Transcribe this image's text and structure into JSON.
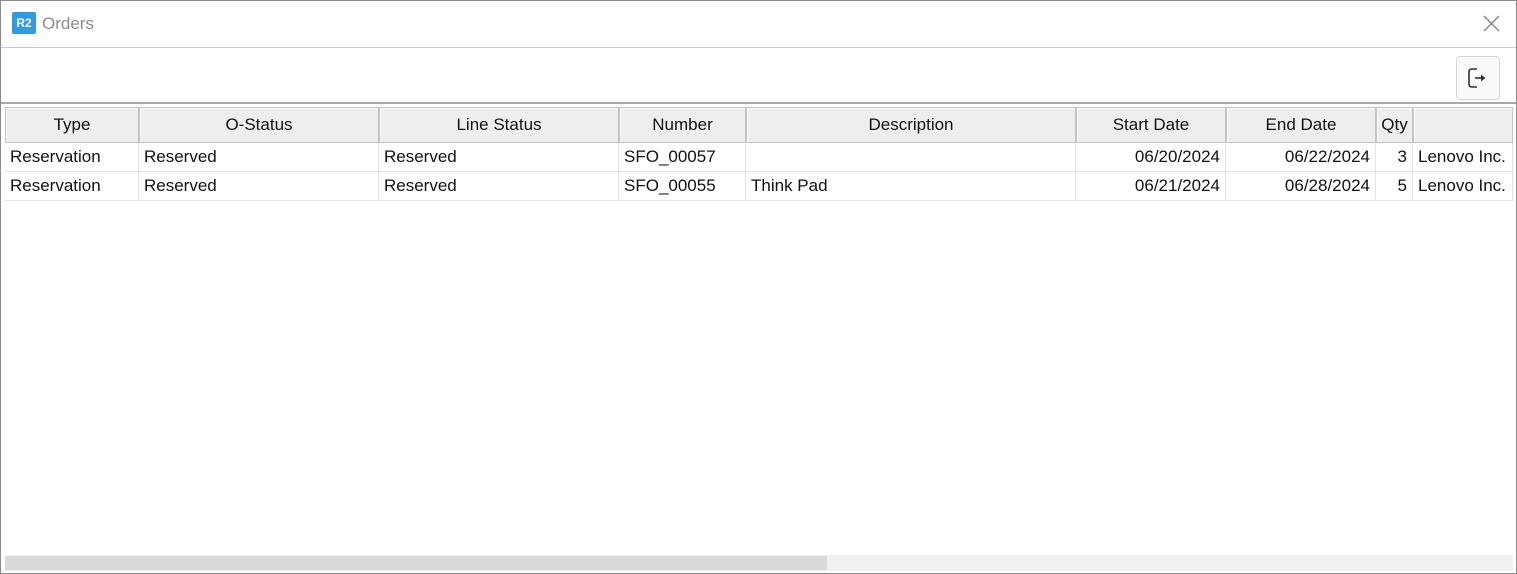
{
  "window": {
    "logo_text": "R2",
    "title": "Orders"
  },
  "toolbar": {
    "exit_icon": "exit-icon"
  },
  "grid": {
    "columns": [
      "Type",
      "O-Status",
      "Line Status",
      "Number",
      "Description",
      "Start Date",
      "End Date",
      "Qty",
      ""
    ],
    "rows": [
      {
        "type": "Reservation",
        "o_status": "Reserved",
        "line_status": "Reserved",
        "number": "SFO_00057",
        "description": "",
        "start_date": "06/20/2024",
        "end_date": "06/22/2024",
        "qty": "3",
        "vendor": "Lenovo Inc."
      },
      {
        "type": "Reservation",
        "o_status": "Reserved",
        "line_status": "Reserved",
        "number": "SFO_00055",
        "description": "Think Pad",
        "start_date": "06/21/2024",
        "end_date": "06/28/2024",
        "qty": "5",
        "vendor": "Lenovo Inc."
      }
    ]
  },
  "colors": {
    "logo_bg": "#2f9be0",
    "header_bg": "#eeeeee",
    "title_text": "#8c8c8c"
  }
}
